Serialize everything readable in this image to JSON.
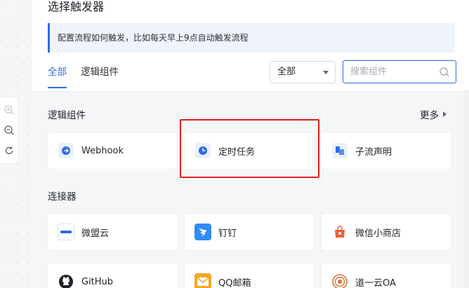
{
  "panel": {
    "title": "选择触发器",
    "notice": "配置流程如何触发，比如每天早上9点自动触发流程"
  },
  "tabs": [
    {
      "label": "全部",
      "active": true
    },
    {
      "label": "逻辑组件",
      "active": false
    }
  ],
  "filter_select": {
    "value": "全部"
  },
  "search": {
    "placeholder": "搜索组件"
  },
  "sections": {
    "logic": {
      "title": "逻辑组件",
      "more_label": "更多",
      "items": [
        {
          "label": "Webhook",
          "icon": "webhook-icon"
        },
        {
          "label": "定时任务",
          "icon": "timer-icon"
        },
        {
          "label": "子流声明",
          "icon": "subflow-icon"
        }
      ]
    },
    "connectors": {
      "title": "连接器",
      "items": [
        {
          "label": "微盟云",
          "icon": "weimob-logo"
        },
        {
          "label": "钉钉",
          "icon": "dingtalk-logo"
        },
        {
          "label": "微信小商店",
          "icon": "wechat-shop-logo"
        },
        {
          "label": "GitHub",
          "icon": "github-logo"
        },
        {
          "label": "QQ邮箱",
          "icon": "qq-mail-logo"
        },
        {
          "label": "道一云OA",
          "icon": "daoyiyun-logo"
        }
      ]
    }
  },
  "colors": {
    "accent": "#2e6be6",
    "highlight": "#e0201b",
    "dingtalk": "#2f8cf5",
    "wechat_shop": "#f0603a",
    "qq_mail": "#f5a623",
    "daoyiyun": "#d9723a"
  }
}
